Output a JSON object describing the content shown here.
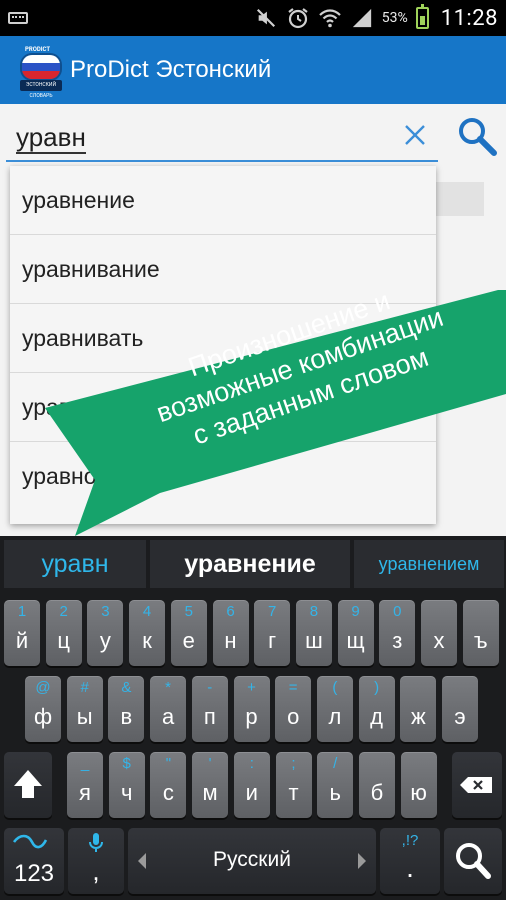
{
  "status_bar": {
    "battery_percent": "53%",
    "time": "11:28",
    "icons": [
      "keyboard-icon",
      "mute-icon",
      "alarm-icon",
      "wifi-icon",
      "signal-icon",
      "battery-icon"
    ]
  },
  "action_bar": {
    "title": "ProDict Эстонский",
    "logo_brand": "PRODICT",
    "logo_caption": "ЭСТОНСКИЙ СЛОВАРЬ"
  },
  "search": {
    "query": "уравн",
    "clear_icon": "close-icon",
    "search_icon": "search-icon"
  },
  "suggestions": [
    "уравнение",
    "уравнивание",
    "уравнивать",
    "уравниловка",
    "уравновесить"
  ],
  "callout": {
    "lines": [
      "Произношение и",
      "возможные комбинации",
      "с заданным словом"
    ],
    "color": "#16a36b"
  },
  "keyboard": {
    "suggestion_strip": {
      "left": "уравн",
      "middle": "уравнение",
      "right": "уравнением"
    },
    "rows": [
      [
        {
          "sec": "1",
          "pri": "й"
        },
        {
          "sec": "2",
          "pri": "ц"
        },
        {
          "sec": "3",
          "pri": "у"
        },
        {
          "sec": "4",
          "pri": "к"
        },
        {
          "sec": "5",
          "pri": "е"
        },
        {
          "sec": "6",
          "pri": "н"
        },
        {
          "sec": "7",
          "pri": "г"
        },
        {
          "sec": "8",
          "pri": "ш"
        },
        {
          "sec": "9",
          "pri": "щ"
        },
        {
          "sec": "0",
          "pri": "з"
        },
        {
          "sec": "",
          "pri": "х"
        },
        {
          "sec": "",
          "pri": "ъ"
        }
      ],
      [
        {
          "sec": "@",
          "pri": "ф"
        },
        {
          "sec": "#",
          "pri": "ы"
        },
        {
          "sec": "&",
          "pri": "в"
        },
        {
          "sec": "*",
          "pri": "а"
        },
        {
          "sec": "-",
          "pri": "п"
        },
        {
          "sec": "+",
          "pri": "р"
        },
        {
          "sec": "=",
          "pri": "о"
        },
        {
          "sec": "(",
          "pri": "л"
        },
        {
          "sec": ")",
          "pri": "д"
        },
        {
          "sec": "",
          "pri": "ж"
        },
        {
          "sec": "",
          "pri": "э"
        }
      ],
      [
        {
          "sec": "_",
          "pri": "я"
        },
        {
          "sec": "$",
          "pri": "ч"
        },
        {
          "sec": "\"",
          "pri": "с"
        },
        {
          "sec": "'",
          "pri": "м"
        },
        {
          "sec": ":",
          "pri": "и"
        },
        {
          "sec": ";",
          "pri": "т"
        },
        {
          "sec": "/",
          "pri": "ь"
        },
        {
          "sec": "",
          "pri": "б"
        },
        {
          "sec": "",
          "pri": "ю"
        }
      ]
    ],
    "bottom": {
      "numbers_label": "123",
      "comma_label": ",",
      "language_label": "Русский",
      "period_sec": ",!?",
      "period_label": "."
    },
    "accent_color": "#2fb7ea"
  }
}
